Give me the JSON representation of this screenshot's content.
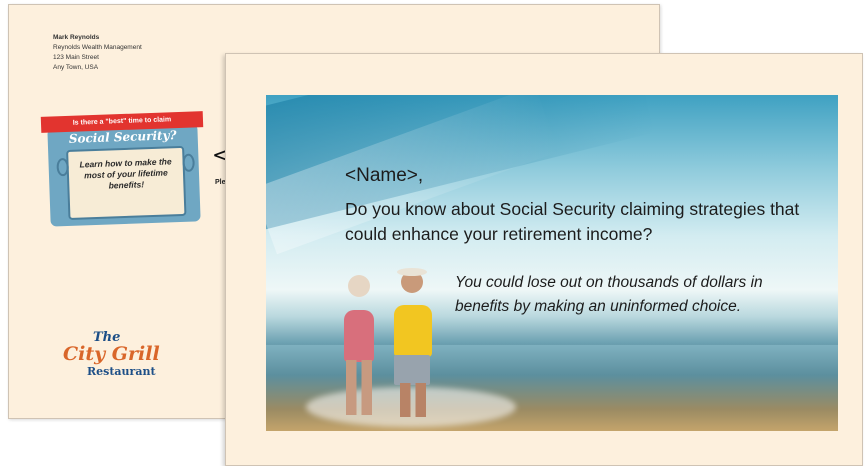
{
  "back_card": {
    "return_address": {
      "name": "Mark Reynolds",
      "company": "Reynolds Wealth Management",
      "street": "123 Main Street",
      "city": "Any Town, USA"
    },
    "badge": {
      "ribbon": "Is there a \"best\" time to claim",
      "title": "Social Security?",
      "body": "Learn how to make the most of your lifetime benefits!"
    },
    "recipient_truncated": "<N",
    "please_truncated": "Plea",
    "logo": {
      "line1": "The",
      "line2": "City Grill",
      "line3": "Restaurant"
    }
  },
  "front_card": {
    "greeting": "<Name>,",
    "question": "Do you know about Social Security claiming strategies that could enhance your retirement income?",
    "subtext": "You could lose out on thousands of dollars in benefits by making an uninformed choice."
  },
  "colors": {
    "card_background": "#fdf0dd",
    "badge_blue": "#6fa7c3",
    "ribbon_red": "#e2342f",
    "logo_orange": "#d9662a",
    "logo_blue": "#1d4f87"
  }
}
